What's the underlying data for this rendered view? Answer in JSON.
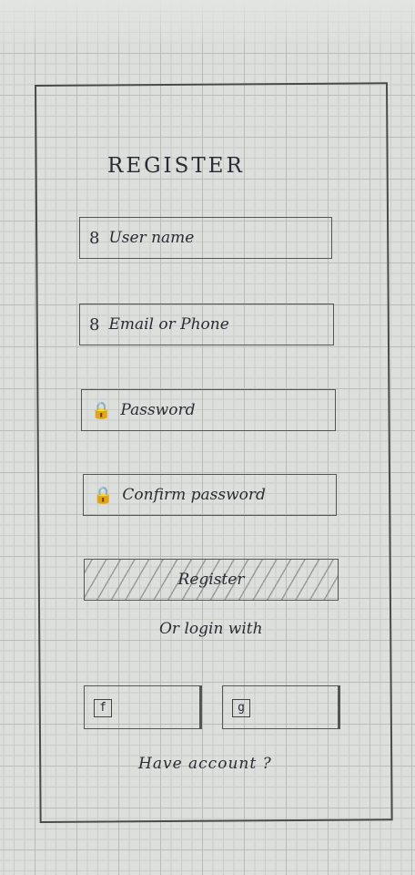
{
  "screen": {
    "title": "REGISTER",
    "fields": {
      "username": {
        "icon": "user-icon",
        "glyph": "8",
        "placeholder": "User name"
      },
      "email": {
        "icon": "user-icon",
        "glyph": "8",
        "placeholder": "Email or Phone"
      },
      "password": {
        "icon": "lock-icon",
        "glyph": "🔒",
        "placeholder": "Password"
      },
      "confirm": {
        "icon": "lock-icon",
        "glyph": "🔒",
        "placeholder": "Confirm password"
      }
    },
    "register_button": "Register",
    "or_login_with": "Or login with",
    "social": {
      "facebook": {
        "icon": "facebook-icon",
        "glyph": "f"
      },
      "google": {
        "icon": "google-icon",
        "glyph": "g"
      }
    },
    "have_account": "Have account ?"
  }
}
